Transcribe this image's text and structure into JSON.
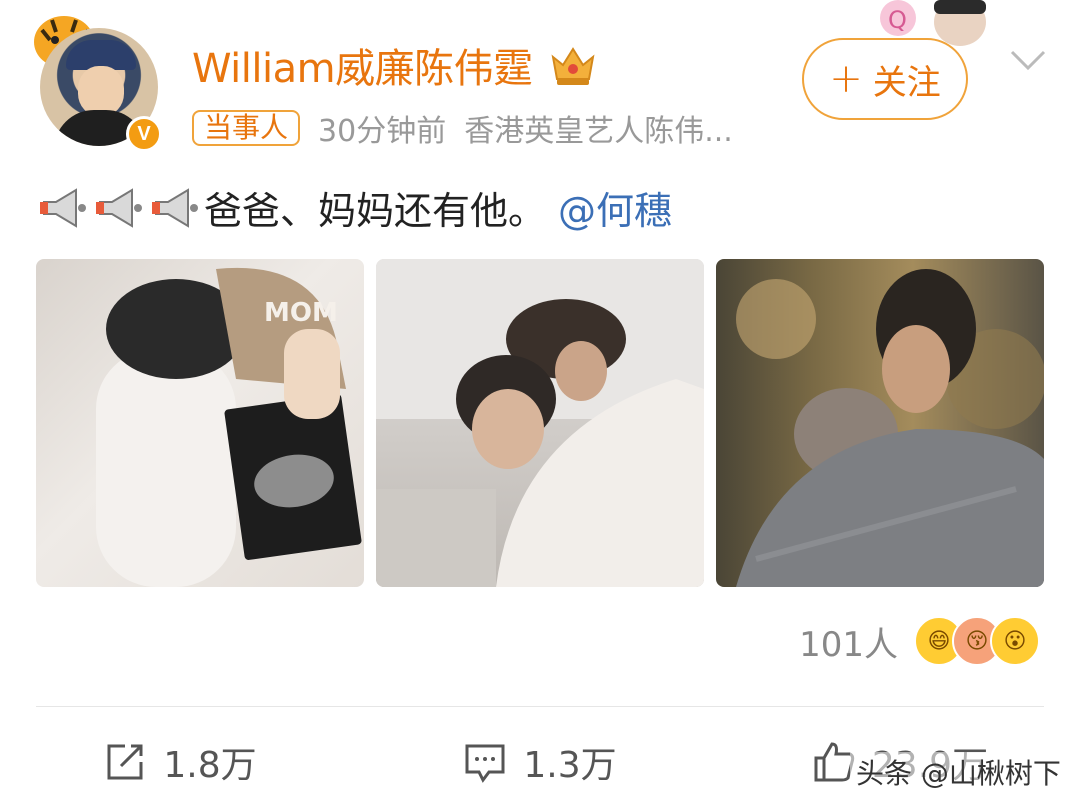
{
  "post": {
    "author_name": "William威廉陈伟霆",
    "author_tag": "当事人",
    "time": "30分钟前",
    "source": "香港英皇艺人陈伟...",
    "follow_label": "关注",
    "follow_plus": "+",
    "text": "爸爸、妈妈还有他。",
    "mention": "@何穗",
    "verified_badge": "V"
  },
  "reactions": {
    "count_label": "101人"
  },
  "actions": {
    "repost_count": "1.8万",
    "comment_count": "1.3万",
    "like_count": "23.9万"
  },
  "watermark": "头条 @山楸树下",
  "colors": {
    "accent": "#e8750e",
    "mention": "#3b6fb6",
    "muted": "#999999"
  },
  "icons": [
    "megaphone-icon",
    "crown-icon",
    "chevron-down-icon",
    "repost-icon",
    "comment-icon",
    "like-icon"
  ]
}
